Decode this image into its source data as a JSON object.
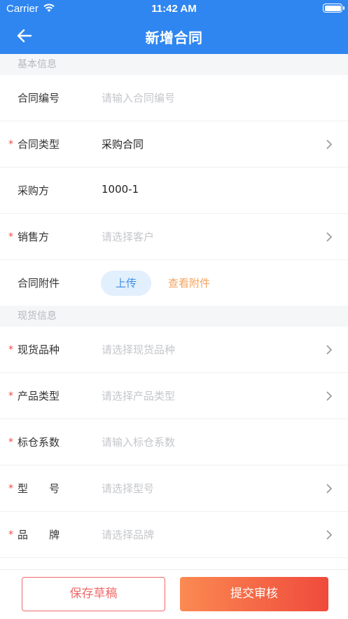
{
  "status_bar": {
    "carrier": "Carrier",
    "time": "11:42 AM"
  },
  "nav": {
    "title": "新增合同"
  },
  "sections": {
    "basic": "基本信息",
    "goods": "现货信息"
  },
  "fields": {
    "contract_no": {
      "label": "合同编号",
      "placeholder": "请输入合同编号"
    },
    "contract_type": {
      "label": "合同类型",
      "value": "采购合同"
    },
    "buyer": {
      "label": "采购方",
      "value": "1000-1"
    },
    "seller": {
      "label": "销售方",
      "placeholder": "请选择客户"
    },
    "attachment": {
      "label": "合同附件",
      "upload": "上传",
      "view": "查看附件"
    },
    "variety": {
      "label": "现货品种",
      "placeholder": "请选择现货品种"
    },
    "product_type": {
      "label": "产品类型",
      "placeholder": "请选择产品类型"
    },
    "coefficient": {
      "label": "标仓系数",
      "placeholder": "请输入标仓系数"
    },
    "model": {
      "label": "型　　号",
      "placeholder": "请选择型号"
    },
    "brand": {
      "label": "品　　牌",
      "placeholder": "请选择品牌"
    }
  },
  "required_mark": "*",
  "actions": {
    "save_draft": "保存草稿",
    "submit": "提交审核"
  },
  "colors": {
    "primary": "#2f86f0",
    "required": "#f04848",
    "accent_orange": "#f5a35c",
    "submit_start": "#fb8a52",
    "submit_end": "#ef4a3c"
  }
}
